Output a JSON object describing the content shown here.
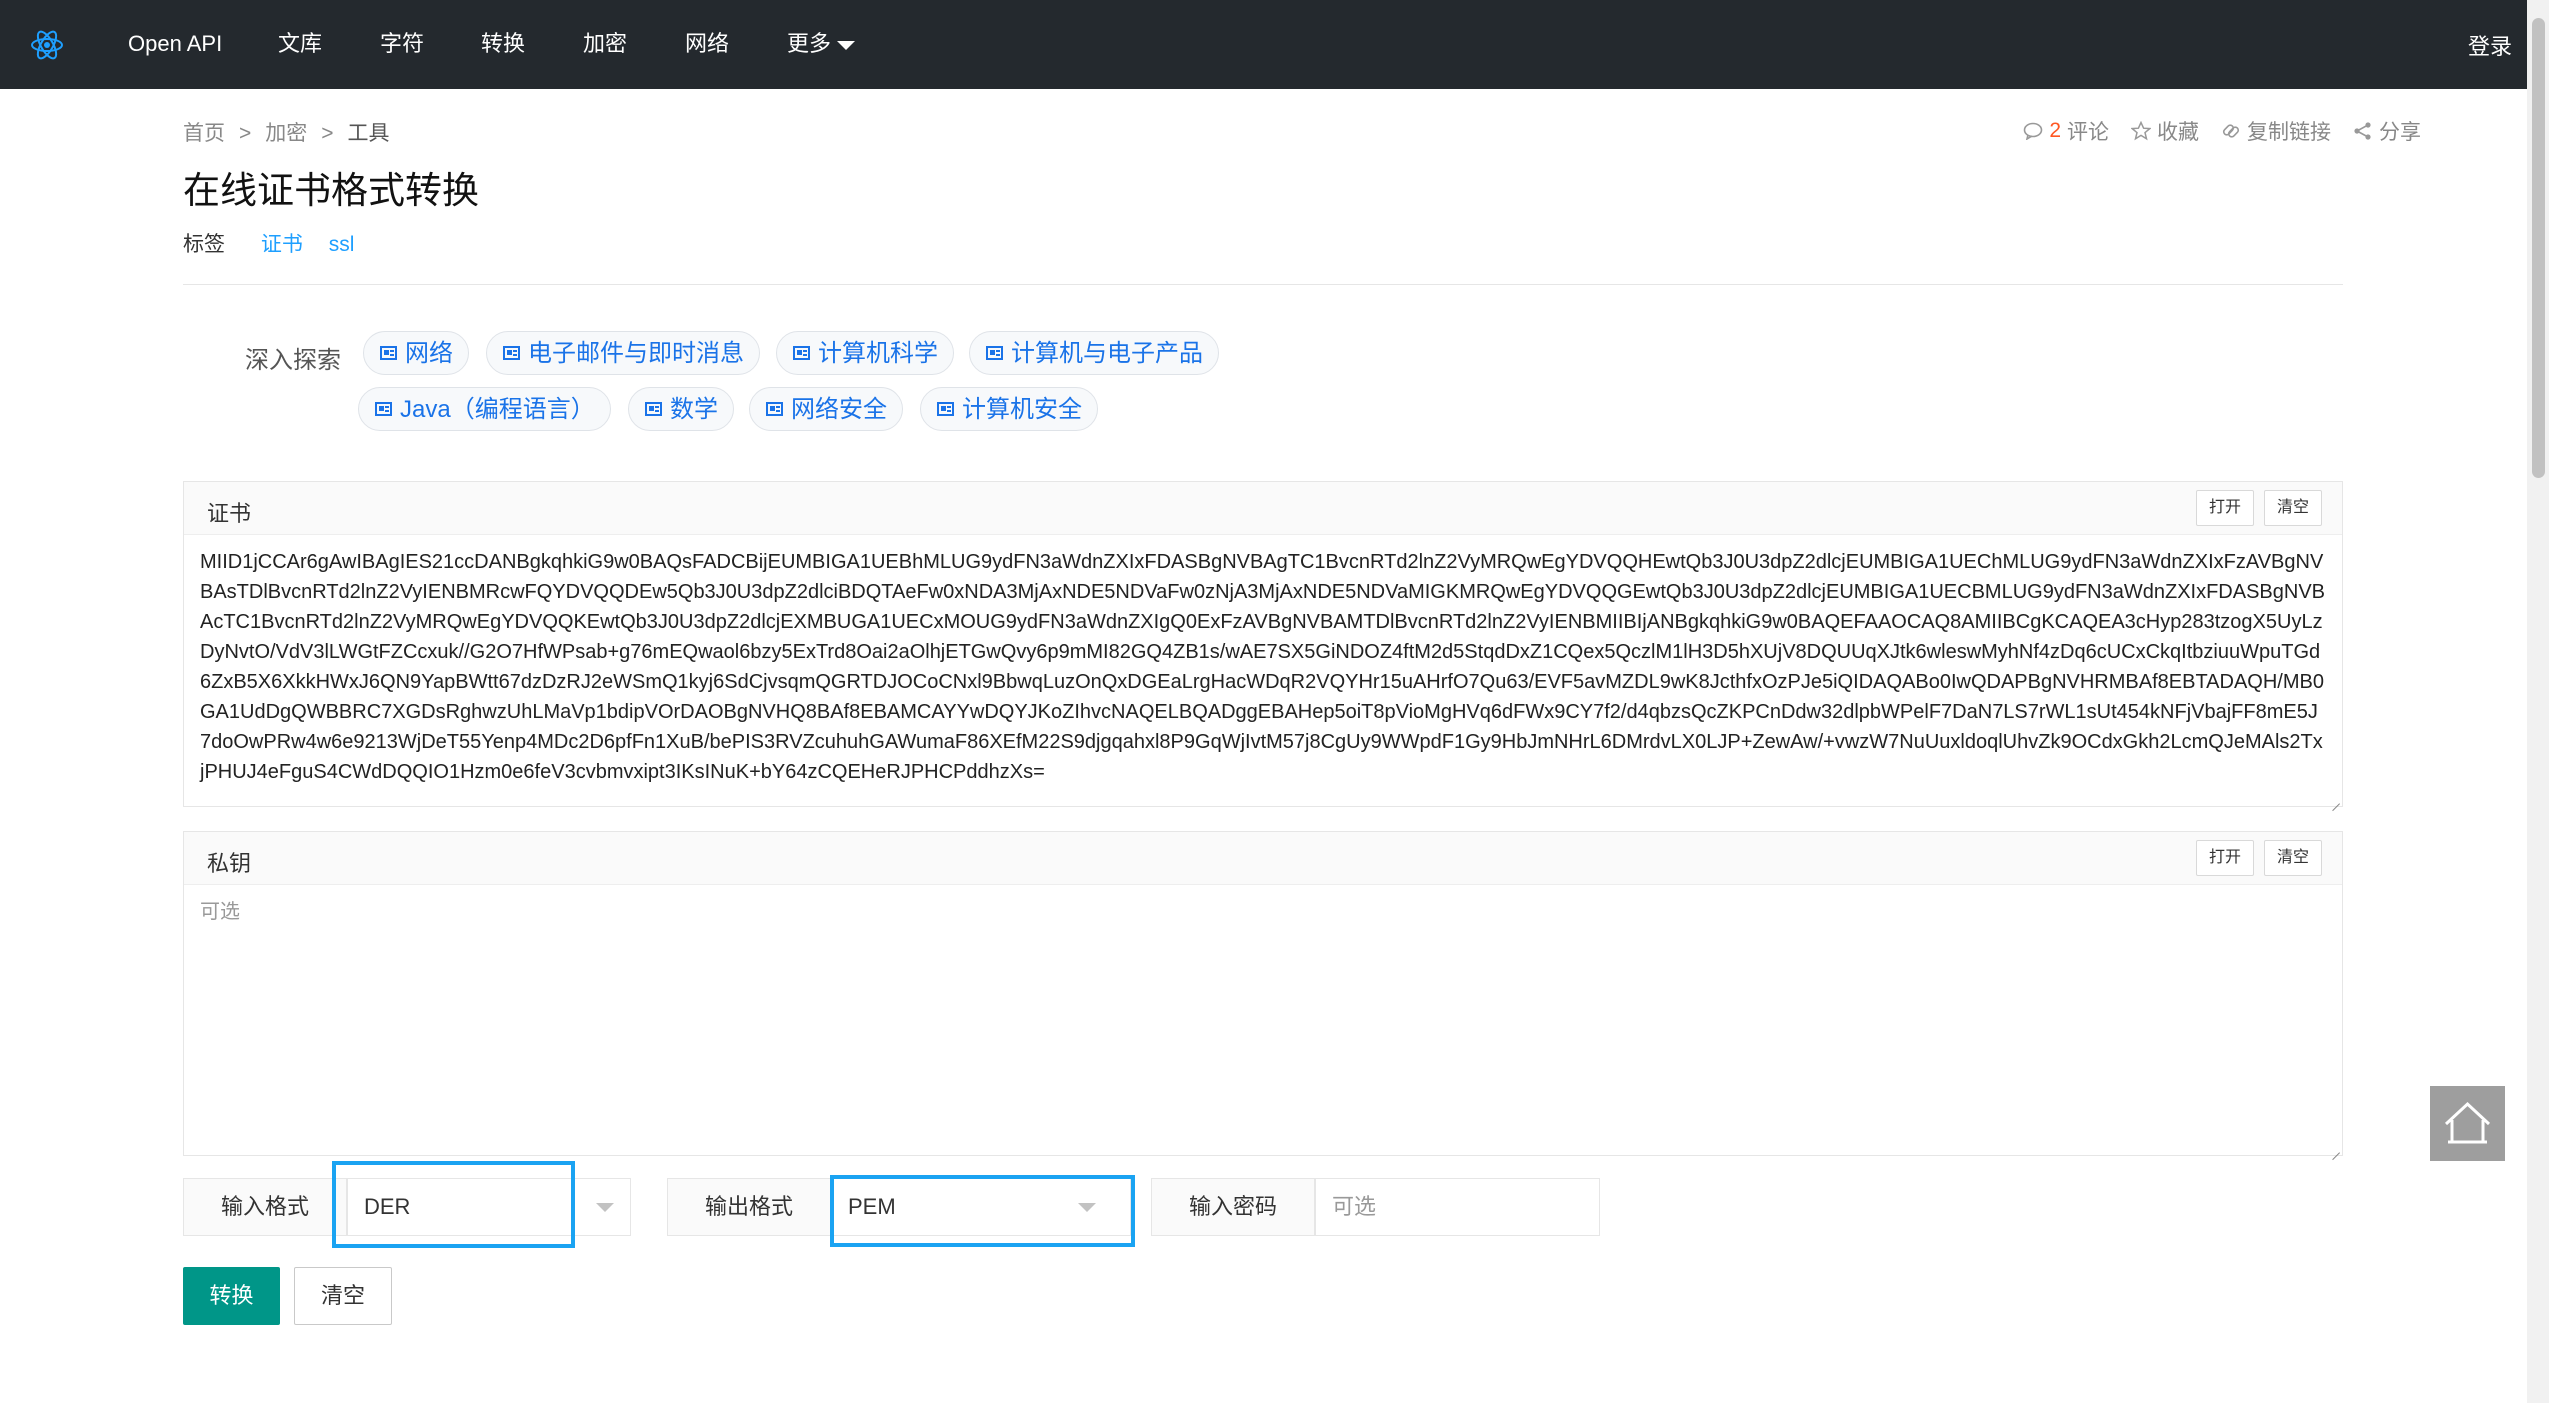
{
  "nav": {
    "items": [
      "Open API",
      "文库",
      "字符",
      "转换",
      "加密",
      "网络",
      "更多"
    ],
    "login": "登录"
  },
  "breadcrumb": {
    "home": "首页",
    "category": "加密",
    "current": "工具",
    "sep": ">"
  },
  "actions": {
    "comment_count": "2",
    "comment": "评论",
    "favorite": "收藏",
    "copy_link": "复制链接",
    "share": "分享"
  },
  "title": "在线证书格式转换",
  "tags": {
    "label": "标签",
    "items": [
      "证书",
      "ssl"
    ]
  },
  "explore": {
    "label": "深入探索",
    "chips": [
      "网络",
      "电子邮件与即时消息",
      "计算机科学",
      "计算机与电子产品",
      "Java（编程语言）",
      "数学",
      "网络安全",
      "计算机安全"
    ]
  },
  "certificate": {
    "label": "证书",
    "open": "打开",
    "clear": "清空",
    "value": "MIID1jCCAr6gAwIBAgIES21ccDANBgkqhkiG9w0BAQsFADCBijEUMBIGA1UEBhMLUG9ydFN3aWdnZXIxFDASBgNVBAgTC1BvcnRTd2lnZ2VyMRQwEgYDVQQHEwtQb3J0U3dpZ2dlcjEUMBIGA1UEChMLUG9ydFN3aWdnZXIxFzAVBgNVBAsTDlBvcnRTd2lnZ2VyIENBMRcwFQYDVQQDEw5Qb3J0U3dpZ2dlciBDQTAeFw0xNDA3MjAxNDE5NDVaFw0zNjA3MjAxNDE5NDVaMIGKMRQwEgYDVQQGEwtQb3J0U3dpZ2dlcjEUMBIGA1UECBMLUG9ydFN3aWdnZXIxFDASBgNVBAcTC1BvcnRTd2lnZ2VyMRQwEgYDVQQKEwtQb3J0U3dpZ2dlcjEXMBUGA1UECxMOUG9ydFN3aWdnZXIgQ0ExFzAVBgNVBAMTDlBvcnRTd2lnZ2VyIENBMIIBIjANBgkqhkiG9w0BAQEFAAOCAQ8AMIIBCgKCAQEA3cHyp283tzogX5UyLzDyNvtO/VdV3lLWGtFZCcxuk//G2O7HfWPsab+g76mEQwaol6bzy5ExTrd8Oai2aOlhjETGwQvy6p9mMI82GQ4ZB1s/wAE7SX5GiNDOZ4ftM2d5StqdDxZ1CQex5QczlM1lH3D5hXUjV8DQUUqXJtk6wleswMyhNf4zDq6cUCxCkqItbziuuWpuTGd6ZxB5X6XkkHWxJ6QN9YapBWtt67dzDzRJ2eWSmQ1kyj6SdCjvsqmQGRTDJOCoCNxl9BbwqLuzOnQxDGEaLrgHacWDqR2VQYHr15uAHrfO7Qu63/EVF5avMZDL9wK8JcthfxOzPJe5iQIDAQABo0IwQDAPBgNVHRMBAf8EBTADAQH/MB0GA1UdDgQWBBRC7XGDsRghwzUhLMaVp1bdipVOrDAOBgNVHQ8BAf8EBAMCAYYwDQYJKoZIhvcNAQELBQADggEBAHep5oiT8pVioMgHVq6dFWx9CY7f2/d4qbzsQcZKPCnDdw32dlpbWPelF7DaN7LS7rWL1sUt454kNFjVbajFF8mE5J7doOwPRw4w6e9213WjDeT55Yenp4MDc2D6pfFn1XuB/bePIS3RVZcuhuhGAWumaF86XEfM22S9djgqahxl8P9GqWjIvtM57j8CgUy9WWpdF1Gy9HbJmNHrL6DMrdvLX0LJP+ZewAw/+vwzW7NuUuxldoqlUhvZk9OCdxGkh2LcmQJeMAls2TxjPHUJ4eFguS4CWdDQQIO1Hzm0e6feV3cvbmvxipt3IKsINuK+bY64zCQEHeRJPHCPddhzXs="
  },
  "private_key": {
    "label": "私钥",
    "open": "打开",
    "clear": "清空",
    "placeholder": "可选"
  },
  "format": {
    "input_label": "输入格式",
    "input_value": "DER",
    "output_label": "输出格式",
    "output_value": "PEM",
    "password_label": "输入密码",
    "password_placeholder": "可选"
  },
  "buttons": {
    "convert": "转换",
    "clear": "清空"
  },
  "colors": {
    "nav_bg": "#24292e",
    "primary": "#009688",
    "link": "#1e9fff",
    "highlight": "#1aa3f2"
  }
}
